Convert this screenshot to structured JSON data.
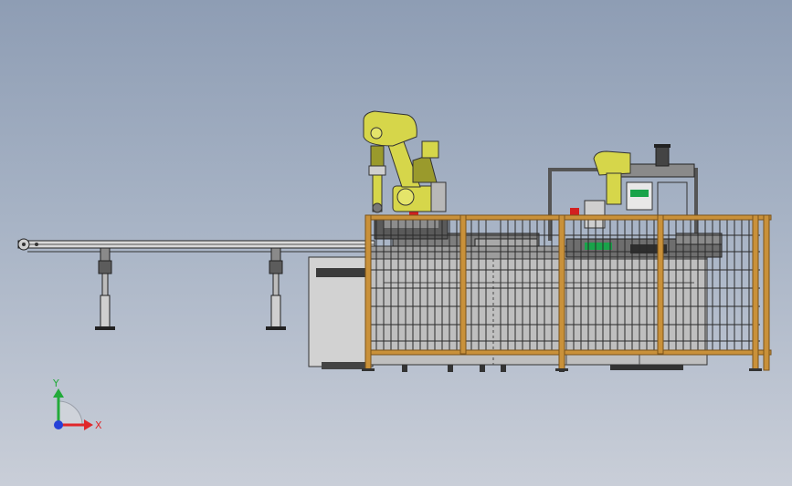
{
  "viewport": {
    "background_top": "#8e9db4",
    "background_bottom": "#c9ced8"
  },
  "colors": {
    "robot_yellow": "#d6d64a",
    "robot_shadow": "#9a9a2c",
    "fence_orange": "#c9913a",
    "fence_mesh": "#2a2a2a",
    "machine_gray": "#c8c8c8",
    "machine_dark": "#5a5a5a",
    "accent_green": "#19a34a",
    "accent_red": "#d22020"
  },
  "triad": {
    "x_label": "X",
    "y_label": "Y",
    "x_color": "#e0262a",
    "y_color": "#22aa3a",
    "z_color": "#2540d8"
  },
  "model": {
    "objects": [
      "conveyor",
      "robot-left",
      "robot-right",
      "machine-base",
      "safety-fence"
    ]
  }
}
